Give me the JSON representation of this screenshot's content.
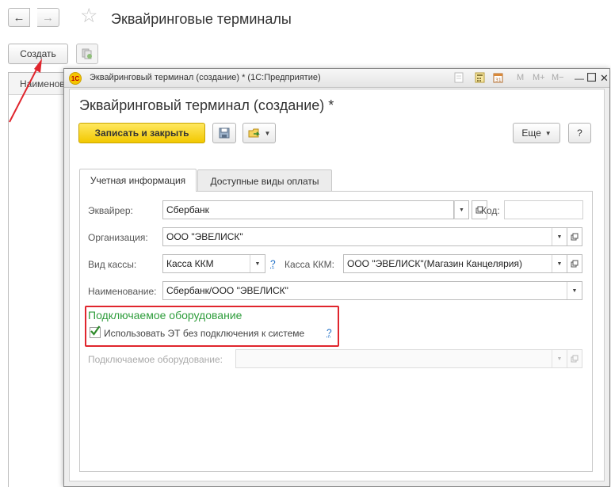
{
  "main": {
    "title": "Эквайринговые терминалы",
    "create_label": "Создать",
    "list_header": "Наименование"
  },
  "window": {
    "titlebar": "Эквайринговый терминал (создание) * (1С:Предприятие)",
    "logo_text": "1С",
    "m_buttons": [
      "M",
      "M+",
      "M−"
    ],
    "form_title": "Эквайринговый терминал (создание) *",
    "write_close_label": "Записать и закрыть",
    "more_label": "Еще",
    "help_label": "?",
    "tabs": [
      "Учетная информация",
      "Доступные виды оплаты"
    ],
    "fields": {
      "acquirer_label": "Эквайрер:",
      "acquirer_value": "Сбербанк",
      "code_label": "Код:",
      "code_value": "",
      "org_label": "Организация:",
      "org_value": "ООО \"ЭВЕЛИСК\"",
      "cash_type_label": "Вид кассы:",
      "cash_type_value": "Касса ККМ",
      "cash_register_label": "Касса ККМ:",
      "cash_register_value": "ООО \"ЭВЕЛИСК\"(Магазин Канцелярия)",
      "name_label": "Наименование:",
      "name_value": "Сбербанк/ООО \"ЭВЕЛИСК\""
    },
    "equipment_group": {
      "title": "Подключаемое оборудование",
      "checkbox_label": "Использовать ЭТ без подключения к системе",
      "checkbox_checked": true,
      "equipment_label": "Подключаемое оборудование:",
      "equipment_value": ""
    }
  },
  "colors": {
    "accent_yellow": "#f2c800",
    "group_green": "#2f9d3c",
    "highlight_red": "#e0252d",
    "link_blue": "#1f6fc6"
  }
}
